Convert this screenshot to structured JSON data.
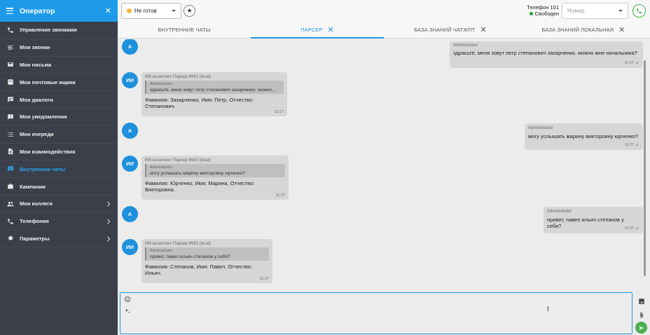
{
  "sidebar": {
    "title": "Оператор",
    "items": [
      {
        "label": "Управление звонками",
        "icon": "phone-icon"
      },
      {
        "label": "Мои звонки",
        "icon": "list-icon"
      },
      {
        "label": "Мои письма",
        "icon": "mail-icon"
      },
      {
        "label": "Мои почтовые ящики",
        "icon": "inbox-icon"
      },
      {
        "label": "Мои диалоги",
        "icon": "chat-icon"
      },
      {
        "label": "Мои уведомления",
        "icon": "notification-icon"
      },
      {
        "label": "Мои очереди",
        "icon": "queue-icon"
      },
      {
        "label": "Мои взаимодействия",
        "icon": "document-icon"
      },
      {
        "label": "Внутренние чаты",
        "icon": "internal-chat-icon",
        "active": true
      },
      {
        "label": "Кампании",
        "icon": "briefcase-icon"
      },
      {
        "label": "Мои коллеги",
        "icon": "people-icon",
        "expandable": true
      },
      {
        "label": "Телефония",
        "icon": "phone-icon",
        "expandable": true
      },
      {
        "label": "Параметры",
        "icon": "gear-icon",
        "expandable": true
      }
    ],
    "active_color": "#2aa3ee"
  },
  "topbar": {
    "status": "Не готов",
    "status_color": "#f5b83d",
    "phone_label": "Телефон 101",
    "phone_state": "Свободен",
    "number_placeholder": "Номер"
  },
  "tabs": [
    {
      "label": "ВНУТРЕННИЕ ЧАТЫ",
      "closable": false
    },
    {
      "label": "ПАРСЕР",
      "closable": true,
      "active": true
    },
    {
      "label": "БАЗА ЗНАНИЙ ЧАТЖПТ",
      "closable": true
    },
    {
      "label": "БАЗА ЗНАНИЙ ЛОКАЛЬНАЯ",
      "closable": true
    }
  ],
  "chat": {
    "messages": [
      {
        "sender": "Administrator",
        "text": "здрасьте, меня зовут петр степанович захарченко. можно мне начальника?",
        "time": "11:27",
        "avatar": "А"
      },
      {
        "sender": "ИИ-ассистент Парсер ФИО (local)",
        "avatar": "ИИ",
        "quote_author": "Administrator",
        "quote_text": "здрасьте, меня зовут петр степанович захарченко. можно...",
        "text": "Фамилия: Захарченко, Имя: Петр, Отчество: Степанович.",
        "time": "11:27"
      },
      {
        "sender": "Administrator",
        "text": "могу услышать марину викторовну юрченко?",
        "time": "11:27",
        "avatar": "А"
      },
      {
        "sender": "ИИ-ассистент Парсер ФИО (local)",
        "avatar": "ИИ",
        "quote_author": "Administrator",
        "quote_text": "могу услышать марину викторовну юрченко?",
        "text": "Фамилия: Юрченко, Имя: Марина, Отчество: Викторовна.",
        "time": "11:27"
      },
      {
        "sender": "Administrator",
        "text": "привет, павел ильич степанов у себя?",
        "time": "11:27",
        "avatar": "А"
      },
      {
        "sender": "ИИ-ассистент Парсер ФИО (local)",
        "avatar": "ИИ",
        "quote_author": "Administrator",
        "quote_text": "привет, павел ильич степанов у себя?",
        "text": "Фамилия: Степанов, Имя: Павел, Отчество: Ильич.",
        "time": "11:27"
      }
    ]
  }
}
